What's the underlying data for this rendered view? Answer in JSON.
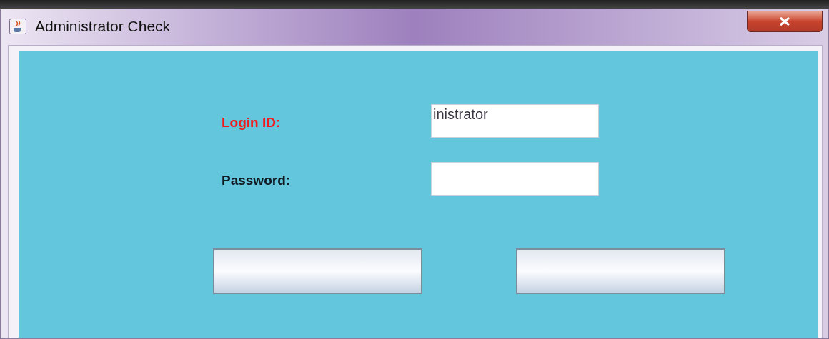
{
  "window": {
    "title": "Administrator Check"
  },
  "form": {
    "fields": [
      {
        "label": "Login ID:",
        "value": "inistrator",
        "highlighted": true
      },
      {
        "label": "Password:",
        "highlighted": false
      }
    ]
  }
}
